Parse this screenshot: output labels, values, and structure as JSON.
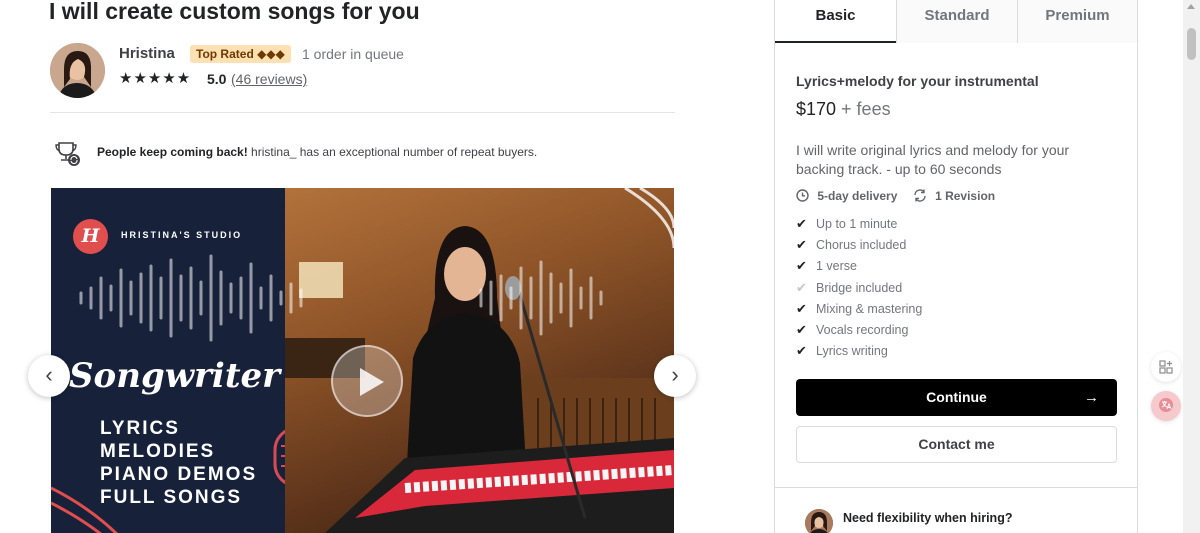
{
  "gig": {
    "title": "I will create custom songs for you"
  },
  "seller": {
    "name": "Hristina",
    "badge": "Top Rated ◆◆◆",
    "queue": "1 order in queue",
    "stars": "★★★★★",
    "rating": "5.0",
    "reviews": "(46 reviews)"
  },
  "repeat_notice": {
    "bold": "People keep coming back!",
    "text": " hristina_ has an exceptional number of repeat buyers."
  },
  "gallery": {
    "logo_letter": "H",
    "studio_name": "HRISTINA'S STUDIO",
    "headline": "Songwriter",
    "skills": [
      "LYRICS",
      "MELODIES",
      "PIANO DEMOS",
      "FULL SONGS"
    ],
    "prev_icon": "‹",
    "next_icon": "›"
  },
  "packages": {
    "tabs": [
      "Basic",
      "Standard",
      "Premium"
    ],
    "active_tab": "Basic",
    "title": "Lyrics+melody for your instrumental",
    "price": "$170",
    "fees": " + fees",
    "description": "I will write original lyrics and melody for your backing track. - up to 60 seconds",
    "delivery": "5-day delivery",
    "revisions": "1 Revision",
    "features": [
      {
        "label": "Up to 1 minute",
        "included": true
      },
      {
        "label": "Chorus included",
        "included": true
      },
      {
        "label": "1 verse",
        "included": true
      },
      {
        "label": "Bridge included",
        "included": false
      },
      {
        "label": "Mixing & mastering",
        "included": true
      },
      {
        "label": "Vocals recording",
        "included": true
      },
      {
        "label": "Lyrics writing",
        "included": true
      }
    ],
    "continue_label": "Continue",
    "continue_arrow": "→",
    "contact_label": "Contact me"
  },
  "flexibility": {
    "title": "Need flexibility when hiring?"
  },
  "colors": {
    "accent_badge": "#ffe0b3",
    "logo_red": "#e04e4e",
    "gallery_navy": "#17213a",
    "primary_button": "#000000"
  }
}
